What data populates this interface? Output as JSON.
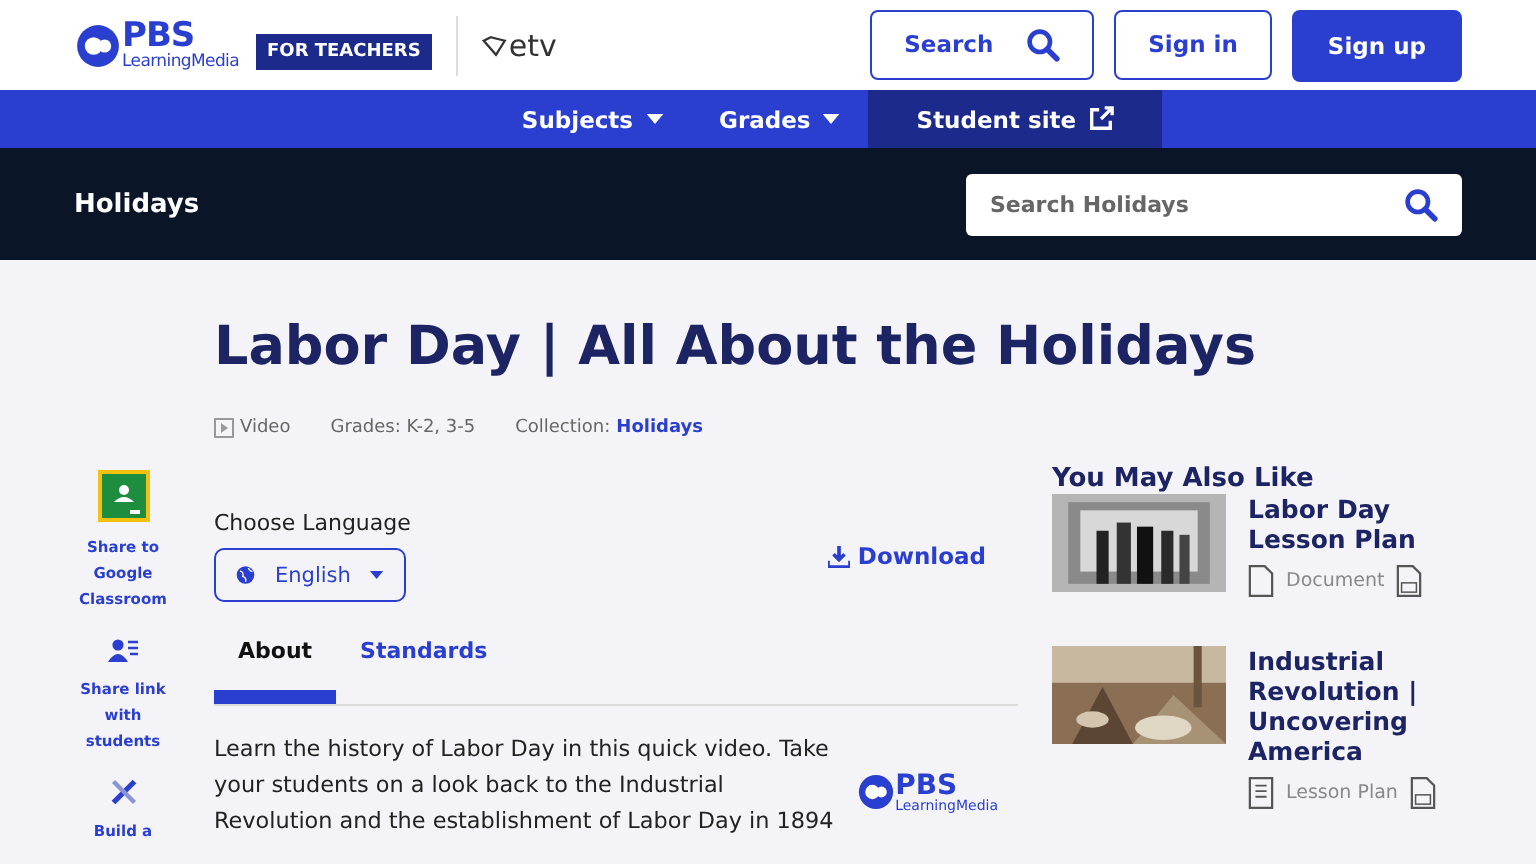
{
  "header": {
    "logo_text": "PBS",
    "logo_sub": "LearningMedia",
    "audience_badge": "FOR TEACHERS",
    "partner": "etv",
    "search_button": "Search",
    "sign_in": "Sign in",
    "sign_up": "Sign up"
  },
  "nav": [
    {
      "label": "Subjects",
      "kind": "dropdown",
      "selected": false
    },
    {
      "label": "Grades",
      "kind": "dropdown",
      "selected": false
    },
    {
      "label": "Student site",
      "kind": "external",
      "selected": true
    }
  ],
  "collection_bar": {
    "title": "Holidays",
    "search_placeholder": "Search Holidays"
  },
  "title": "Labor Day | All About the Holidays",
  "meta": {
    "type": "Video",
    "grades": "Grades: K-2, 3-5",
    "collection_label": "Collection:",
    "collection": "Holidays"
  },
  "share": [
    {
      "label": "Share to Google Classroom",
      "kind": "classroom"
    },
    {
      "label": "Share link with students",
      "kind": "link"
    },
    {
      "label": "Build a",
      "kind": "build"
    }
  ],
  "language": {
    "label": "Choose Language",
    "value": "English"
  },
  "download": "Download",
  "tabs": [
    {
      "label": "About",
      "selected": true
    },
    {
      "label": "Standards",
      "selected": false
    }
  ],
  "description": [
    "Learn the history of Labor Day in this quick video. Take",
    "your students on a look back to the Industrial",
    "Revolution and the establishment of Labor Day in 1894"
  ],
  "provider": {
    "text": "PBS",
    "sub": "LearningMedia"
  },
  "related": {
    "heading": "You May Also Like",
    "items": [
      {
        "title": "Labor Day Lesson Plan",
        "type": "Document",
        "kind": "document"
      },
      {
        "title": "Industrial Revolution | Uncovering America",
        "type": "Lesson Plan",
        "kind": "lesson"
      }
    ]
  }
}
